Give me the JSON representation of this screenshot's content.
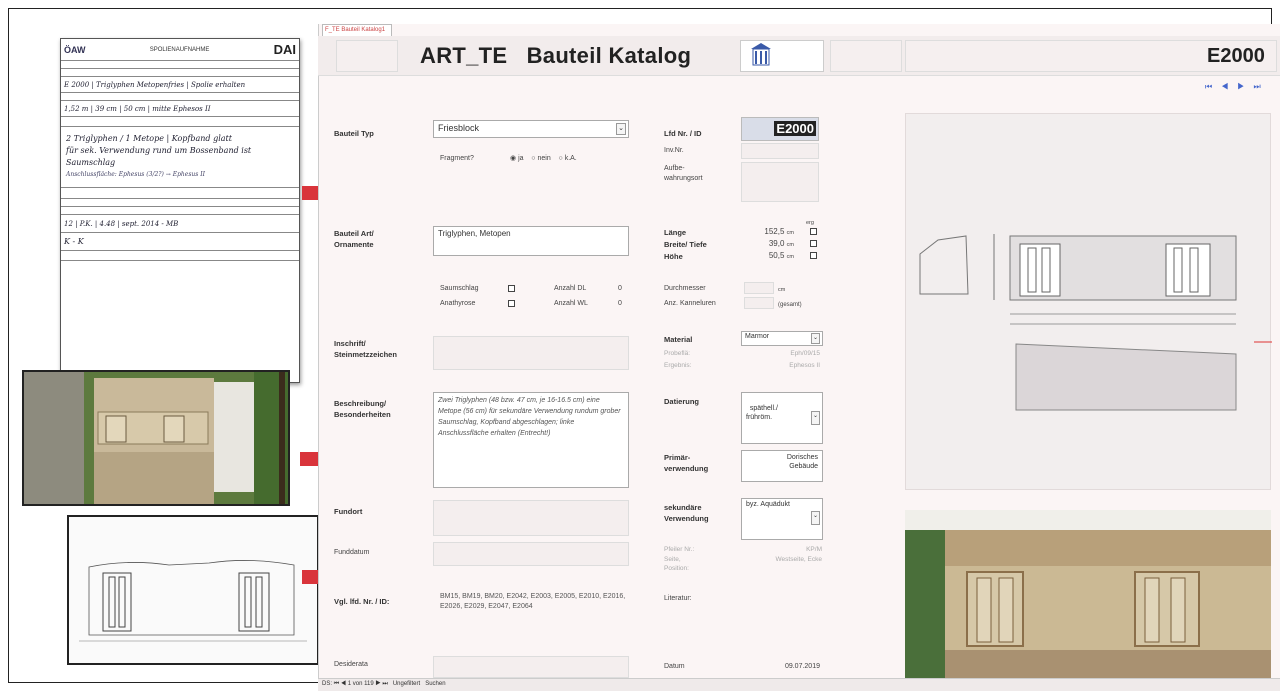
{
  "form": {
    "org_left": "ÖAW",
    "heading": "SPOLIENAUFNAHME",
    "org_right": "DAI",
    "handwriting": [
      "2 Triglyphen / 1 Metope | Kopfband glatt",
      "für sek. Verwendung rund um Bossenband ist",
      "Saumschlag",
      "Anschlussfläche: Ephesus (3/2?) → Ephesus II"
    ],
    "signature": "K - K"
  },
  "app": {
    "tab_label": "F_TE Bauteil Katalog1",
    "title": "ART_TE   Bauteil Katalog",
    "record_id": "E2000",
    "nav_buttons": [
      "first-record",
      "previous-record",
      "next-record",
      "last-record"
    ]
  },
  "fields": {
    "bauteil_typ_label": "Bauteil Typ",
    "bauteil_typ_value": "Friesblock",
    "fragment_label": "Fragment?",
    "fragment_opts": [
      "ja",
      "nein",
      "k.A."
    ],
    "lfd_label": "Lfd Nr. / ID",
    "lfd_value": "E2000",
    "inv_label": "Inv.Nr.",
    "aufbew_label": "Aufbe-\nwahrungsort",
    "art_label": "Bauteil Art/\nOrnamente",
    "art_value": "Triglyphen, Metopen",
    "laenge_label": "Länge",
    "breite_label": "Breite/ Tiefe",
    "hoehe_label": "Höhe",
    "erg_label": "erg",
    "laenge_value": "152,5",
    "breite_value": "39,0",
    "hoehe_value": "50,5",
    "unit_cm": "cm",
    "saumschlag_label": "Saumschlag",
    "anathyrose_label": "Anathyrose",
    "anzahl_dl_label": "Anzahl DL",
    "anzahl_wl_label": "Anzahl WL",
    "anzahl_dl_value": "0",
    "anzahl_wl_value": "0",
    "durchmesser_label": "Durchmesser",
    "kannelur_label": "Anz. Kanneluren",
    "gesamt_label": "(gesamt)",
    "inschrift_label": "Inschrift/\nSteinmetzzeichen",
    "material_label": "Material",
    "material_value": "Marmor",
    "probe_label": "Probeflä:",
    "probe_value": "Eph/09/15",
    "ergebnis_label": "Ergebnis:",
    "ergebnis_value": "Ephesos II",
    "beschr_label": "Beschreibung/\nBesonderheiten",
    "beschr_value": "Zwei Triglyphen (48 bzw. 47 cm, je 16-16.5 cm) eine Metope (56 cm) für sekundäre Verwendung rundum grober Saumschlag, Kopfband abgeschlagen; linke Anschlussfläche erhalten (Entrecht!)",
    "datierung_label": "Datierung",
    "datierung_value": "späthell./\nfrühröm.",
    "primaer_label": "Primär-\nverwendung",
    "primaer_value": "Dorisches\nGebäude",
    "sekundaer_label": "sekundäre\nVerwendung",
    "sekundaer_value": "byz. Aquädukt",
    "fundort_label": "Fundort",
    "pfeiler_label": "Pfeiler Nr.:",
    "pfeiler_value": "KP/M",
    "seite_label": "Seite,\nPosition:",
    "seite_value": "Westseite, Ecke",
    "funddatum_label": "Funddatum",
    "vgl_label": "Vgl. lfd. Nr. / ID:",
    "vgl_value": "BM15, BM19, BM20, E2042, E2003, E2005, E2010, E2016, E2026, E2029, E2047, E2064",
    "literatur_label": "Literatur:",
    "desiderata_label": "Desiderata",
    "datum_label": "Datum",
    "datum_value": "09.07.2019"
  },
  "statusbar": {
    "record_label": "DS:",
    "record_count": "1 von 119",
    "filter": "Ungefiltert",
    "search": "Suchen"
  }
}
